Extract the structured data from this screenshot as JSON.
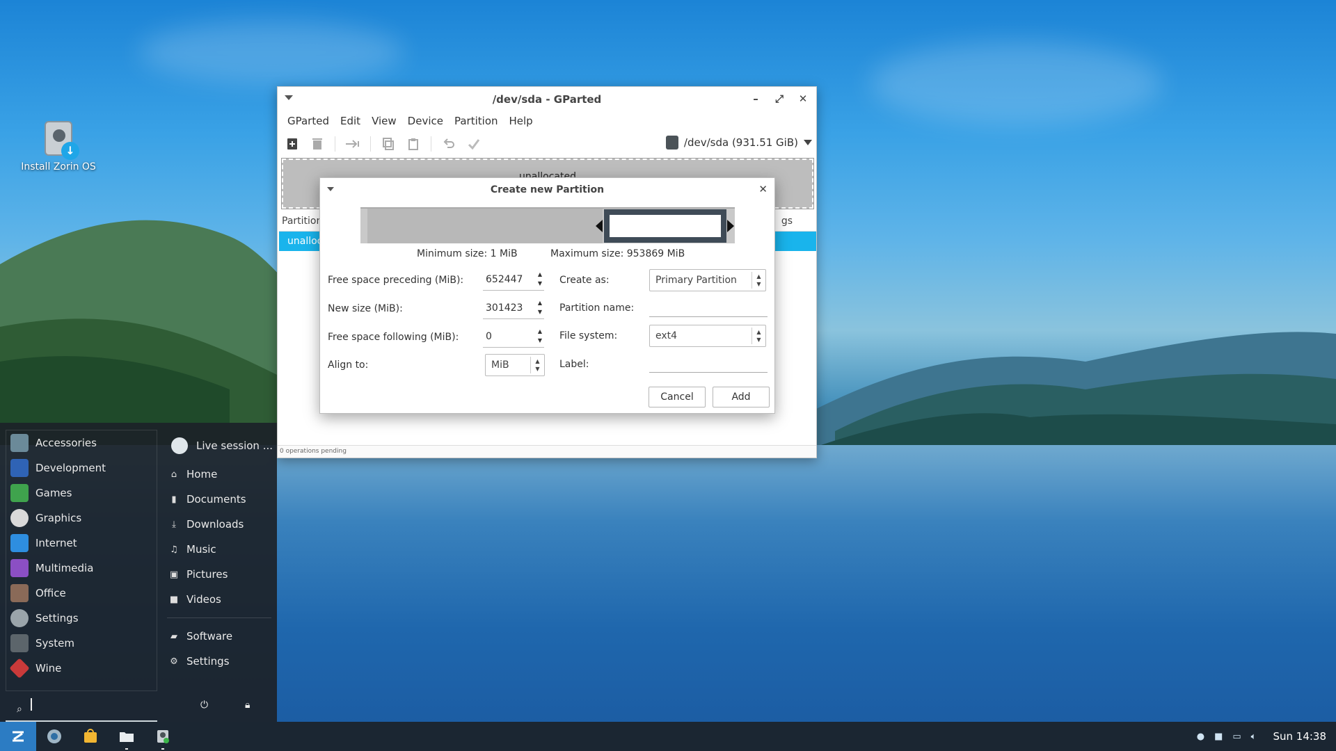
{
  "desktop": {
    "install_icon_label": "Install Zorin OS"
  },
  "gparted": {
    "title": "/dev/sda - GParted",
    "menu": [
      "GParted",
      "Edit",
      "View",
      "Device",
      "Partition",
      "Help"
    ],
    "device_label": "/dev/sda  (931.51 GiB)",
    "graph_label": "unallocated",
    "table_header_left": "Partition",
    "table_header_right": "gs",
    "table_row_label": "unalloc",
    "status": "0 operations pending"
  },
  "dialog": {
    "title": "Create new Partition",
    "min_size": "Minimum size: 1 MiB",
    "max_size": "Maximum size: 953869 MiB",
    "free_preceding_label": "Free space preceding (MiB):",
    "free_preceding_value": "652447",
    "new_size_label": "New size (MiB):",
    "new_size_value": "301423",
    "free_following_label": "Free space following (MiB):",
    "free_following_value": "0",
    "align_label": "Align to:",
    "align_value": "MiB",
    "create_as_label": "Create as:",
    "create_as_value": "Primary Partition",
    "partition_name_label": "Partition name:",
    "partition_name_value": "",
    "file_system_label": "File system:",
    "file_system_value": "ext4",
    "label_label": "Label:",
    "label_value": "",
    "cancel": "Cancel",
    "add": "Add"
  },
  "startmenu": {
    "categories": [
      {
        "label": "Accessories",
        "color": "#6b8a99"
      },
      {
        "label": "Development",
        "color": "#2f63b5"
      },
      {
        "label": "Games",
        "color": "#3fa34d"
      },
      {
        "label": "Graphics",
        "color": "#d9d9d9"
      },
      {
        "label": "Internet",
        "color": "#2e8ee0"
      },
      {
        "label": "Multimedia",
        "color": "#8b4fc4"
      },
      {
        "label": "Office",
        "color": "#8a6a58"
      },
      {
        "label": "Settings",
        "color": "#9aa4aa"
      },
      {
        "label": "System",
        "color": "#5c656b"
      },
      {
        "label": "Wine",
        "color": "#c93a3a"
      }
    ],
    "user": "Live session ...",
    "places": [
      "Home",
      "Documents",
      "Downloads",
      "Music",
      "Pictures",
      "Videos"
    ],
    "extras": [
      "Software",
      "Settings"
    ]
  },
  "taskbar": {
    "clock": "Sun 14:38"
  }
}
